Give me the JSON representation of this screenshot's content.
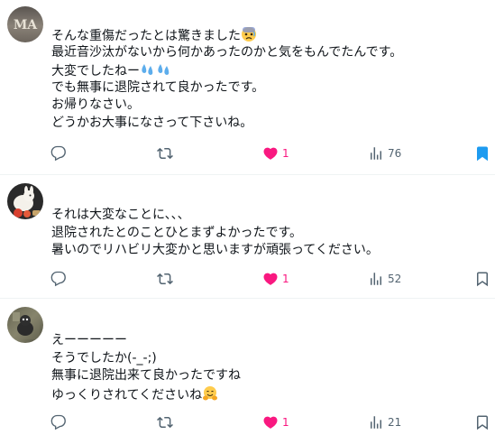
{
  "replies": [
    {
      "lines": [
        "そんな重傷だったとは驚きました",
        "最近音沙汰がないから何かあったのかと気をもんでたんです。",
        "大変でしたねー",
        "でも無事に退院されて良かったです。",
        "お帰りなさい。",
        "どうかお大事になさって下さいね。"
      ],
      "line_emoji": [
        "anxious-face-emoji",
        "",
        "sweat-droplets-emoji",
        "",
        "",
        ""
      ],
      "likes": "1",
      "views": "76",
      "bookmarked": true,
      "avatar_text": "MA"
    },
    {
      "lines": [
        "それは大変なことに、、、",
        "退院されたとのことひとまずよかったです。",
        "暑いのでリハビリ大変かと思いますが頑張ってください。"
      ],
      "likes": "1",
      "views": "52",
      "bookmarked": false
    },
    {
      "lines": [
        "えーーーーー",
        "そうでしたか(-_-;)",
        "無事に退院出来て良かったですね",
        "ゆっくりされてくださいね"
      ],
      "line_emoji": [
        "",
        "",
        "",
        "hugging-face-emoji"
      ],
      "likes": "1",
      "views": "21",
      "bookmarked": false
    }
  ],
  "colors": {
    "text": "#0f1419",
    "muted": "#536471",
    "like": "#f91880",
    "bookmark": "#1d9bf0",
    "divider": "#eff3f4"
  },
  "icons": [
    "reply-icon",
    "repost-icon",
    "like-icon",
    "views-icon",
    "bookmark-icon"
  ]
}
